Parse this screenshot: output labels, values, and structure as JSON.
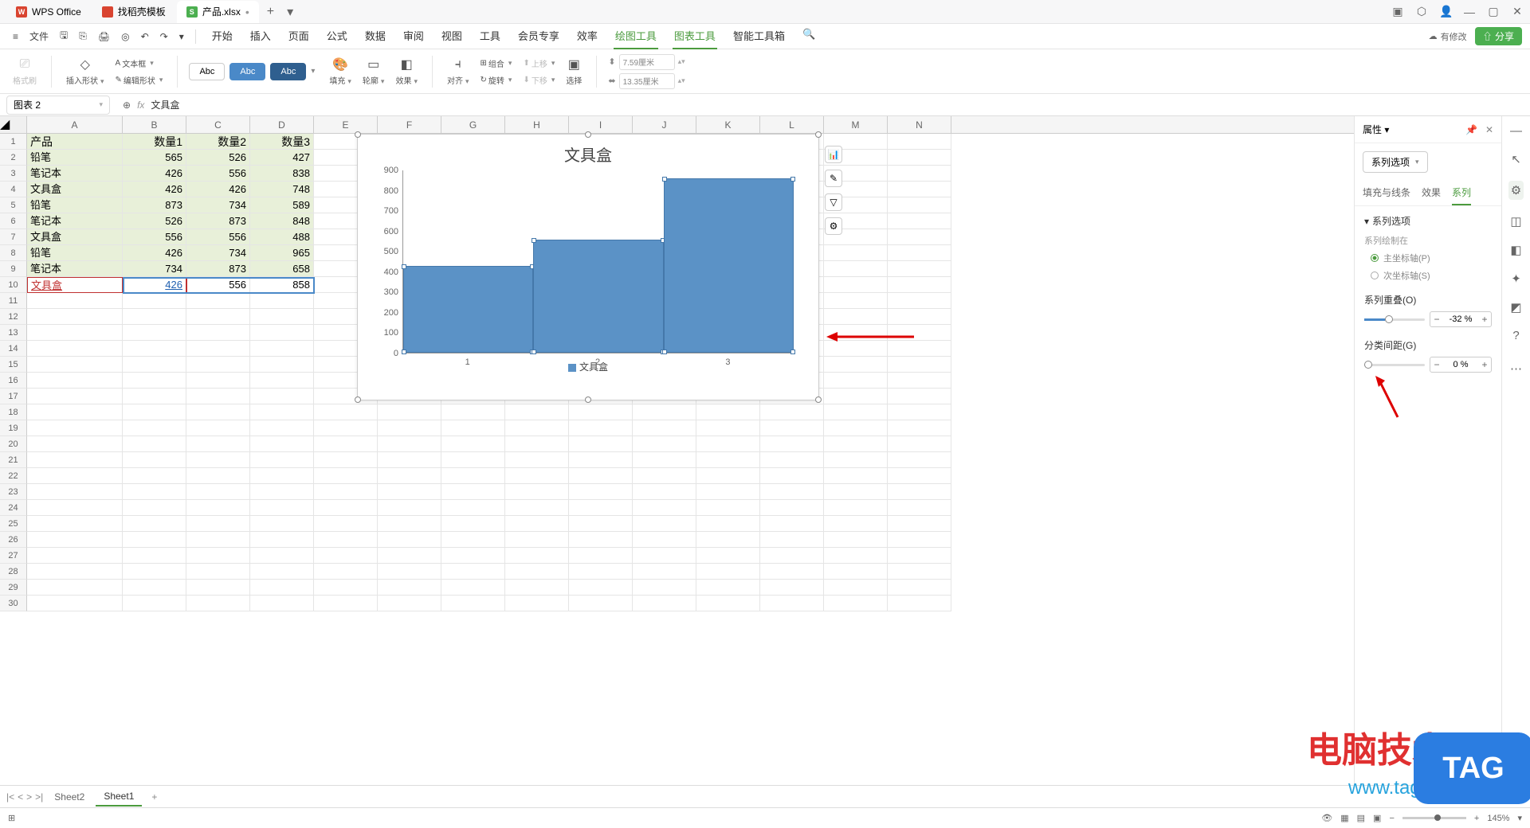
{
  "titlebar": {
    "tabs": [
      {
        "icon": "W",
        "label": "WPS Office"
      },
      {
        "icon": "",
        "label": "找稻壳模板"
      },
      {
        "icon": "S",
        "label": "产品.xlsx",
        "dirty": "•",
        "active": true
      }
    ]
  },
  "menubar": {
    "file": "文件",
    "tabs": [
      "开始",
      "插入",
      "页面",
      "公式",
      "数据",
      "审阅",
      "视图",
      "工具",
      "会员专享",
      "效率",
      "绘图工具",
      "图表工具",
      "智能工具箱"
    ],
    "active_tabs": [
      "绘图工具",
      "图表工具"
    ],
    "modified": "有修改",
    "share": "分享"
  },
  "ribbon": {
    "format_brush": "格式刷",
    "insert_shape": "插入形状",
    "text_box": "文本框",
    "edit_shape": "编辑形状",
    "style_label": "Abc",
    "fill": "填充",
    "outline": "轮廓",
    "effect": "效果",
    "align": "对齐",
    "group": "组合",
    "rotate": "旋转",
    "up": "上移",
    "down": "下移",
    "select": "选择",
    "width": "7.59厘米",
    "height": "13.35厘米"
  },
  "formula": {
    "name_box": "图表 2",
    "text": "文具盒"
  },
  "columns": [
    "A",
    "B",
    "C",
    "D",
    "E",
    "F",
    "G",
    "H",
    "I",
    "J",
    "K",
    "L",
    "M",
    "N"
  ],
  "data": {
    "headers": [
      "产品",
      "数量1",
      "数量2",
      "数量3"
    ],
    "rows": [
      [
        "铅笔",
        "565",
        "526",
        "427"
      ],
      [
        "笔记本",
        "426",
        "556",
        "838"
      ],
      [
        "文具盒",
        "426",
        "426",
        "748"
      ],
      [
        "铅笔",
        "873",
        "734",
        "589"
      ],
      [
        "笔记本",
        "526",
        "873",
        "848"
      ],
      [
        "文具盒",
        "556",
        "556",
        "488"
      ],
      [
        "铅笔",
        "426",
        "734",
        "965"
      ],
      [
        "笔记本",
        "734",
        "873",
        "658"
      ],
      [
        "文具盒",
        "426",
        "556",
        "858"
      ]
    ]
  },
  "chart_data": {
    "type": "bar",
    "title": "文具盒",
    "categories": [
      "1",
      "2",
      "3"
    ],
    "values": [
      426,
      556,
      858
    ],
    "ylim": [
      0,
      900
    ],
    "yticks": [
      "0",
      "100",
      "200",
      "300",
      "400",
      "500",
      "600",
      "700",
      "800",
      "900"
    ],
    "legend": "文具盒",
    "series_name": "文具盒"
  },
  "panel": {
    "title": "属性",
    "series_options": "系列选项",
    "tabs": [
      "填充与线条",
      "效果",
      "系列"
    ],
    "active_tab": "系列",
    "section_series_options": "系列选项",
    "plot_on": "系列绘制在",
    "primary_axis": "主坐标轴(P)",
    "secondary_axis": "次坐标轴(S)",
    "overlap_label": "系列重叠(O)",
    "overlap_value": "-32 %",
    "gap_label": "分类间距(G)",
    "gap_value": "0 %"
  },
  "sheets": {
    "tabs": [
      "Sheet2",
      "Sheet1"
    ],
    "active": "Sheet1"
  },
  "statusbar": {
    "zoom": "145%"
  },
  "watermark": {
    "text1": "电脑技术网",
    "text2": "www.tagxp.com",
    "tag": "TAG"
  }
}
